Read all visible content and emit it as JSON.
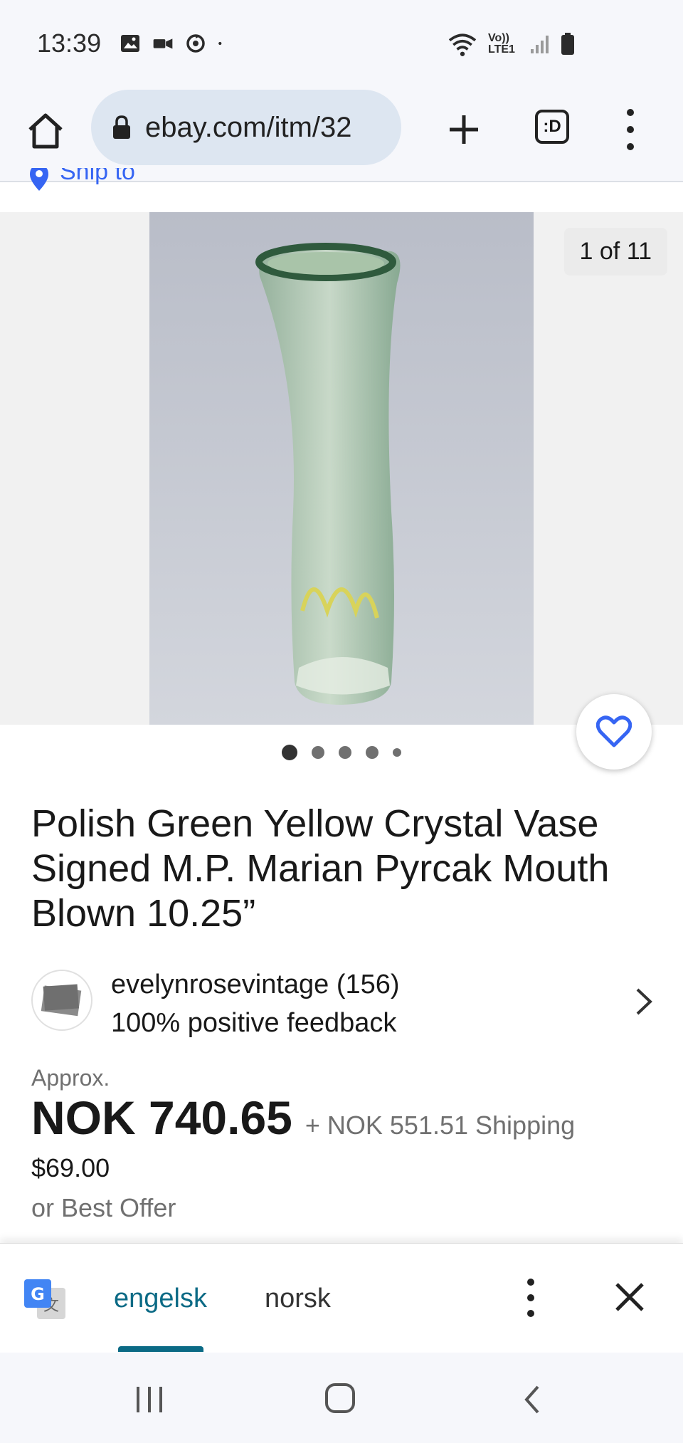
{
  "status_bar": {
    "time": "13:39",
    "left_icons": [
      "gallery-icon",
      "video-icon",
      "sync-icon",
      "dot-icon"
    ],
    "right_icons": [
      "wifi-icon",
      "volte-icon",
      "signal-icon",
      "battery-icon"
    ],
    "volte_label": "Vo)) LTE1"
  },
  "browser": {
    "url": "ebay.com/itm/32",
    "tabs_label": ":D"
  },
  "ship_to": "Ship to",
  "gallery": {
    "counter": "1 of 11",
    "dot_count": 5,
    "active_index": 0
  },
  "listing": {
    "title": "Polish Green Yellow Crystal Vase Signed M.P. Marian Pyrcak Mouth Blown 10.25”",
    "seller_name": "evelynrosevintage (156)",
    "seller_feedback": "100% positive feedback",
    "approx_label": "Approx.",
    "price": "NOK 740.65",
    "shipping": "+ NOK 551.51 Shipping",
    "original_price": "$69.00",
    "best_offer": "or Best Offer"
  },
  "translate_bar": {
    "source_lang": "engelsk",
    "target_lang": "norsk"
  },
  "colors": {
    "ebay_blue": "#3665f3",
    "translate_teal": "#0b6a85",
    "url_bar_bg": "#dde6f1"
  }
}
